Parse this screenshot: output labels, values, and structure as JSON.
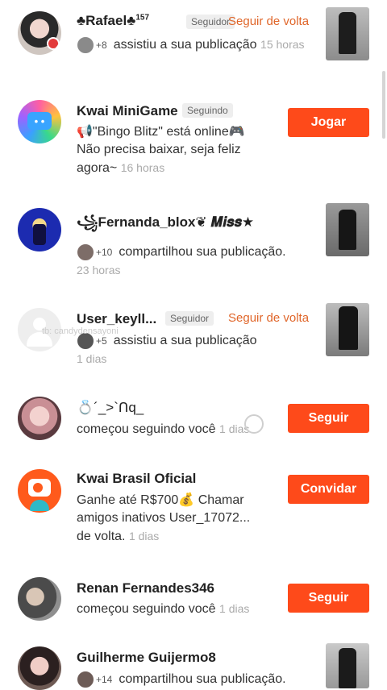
{
  "notifications": [
    {
      "name": "♣Rafael♣",
      "sup": "157",
      "chip": "Seguidor",
      "follow_back": "Seguir de volta",
      "extra_count": "+8",
      "action": "assistiu a sua publicação",
      "time": "15 horas"
    },
    {
      "name": "Kwai MiniGame",
      "chip": "Seguindo",
      "line1": "📢\"Bingo Blitz\" está online🎮",
      "line2": "Não precisa baixar, seja feliz",
      "line3": "agora~",
      "time": "16 horas",
      "button": "Jogar"
    },
    {
      "name": "꧁Fernanda_blox❦ 𝑴𝒊𝒔𝒔★",
      "extra_count": "+10",
      "action": "compartilhou sua publicação.",
      "time": "23 horas"
    },
    {
      "name": "User_keyll...",
      "chip": "Seguidor",
      "follow_back": "Seguir de volta",
      "extra_count": "+5",
      "action": "assistiu a sua publicação",
      "time": "1 dias"
    },
    {
      "name": "💍´_>`ᑎq_",
      "action": "começou seguindo você",
      "time": "1 dias",
      "button": "Seguir"
    },
    {
      "name": "Kwai Brasil Oficial",
      "line1": "Ganhe até R$700💰 Chamar",
      "line2": "amigos inativos User_17072...",
      "line3": "de volta.",
      "time": "1 dias",
      "button": "Convidar"
    },
    {
      "name": "Renan Fernandes346",
      "action": "começou seguindo você",
      "time": "1 dias",
      "button": "Seguir"
    },
    {
      "name": "Guilherme Guijermo8",
      "extra_count": "+14",
      "action": "compartilhou sua publicação."
    }
  ],
  "watermark": "tb: candydensayoni",
  "colors": {
    "accent": "#fe4a1a",
    "follow_back": "#e0662a",
    "chip_bg": "#eeeeee",
    "time": "#aaaaaa"
  }
}
